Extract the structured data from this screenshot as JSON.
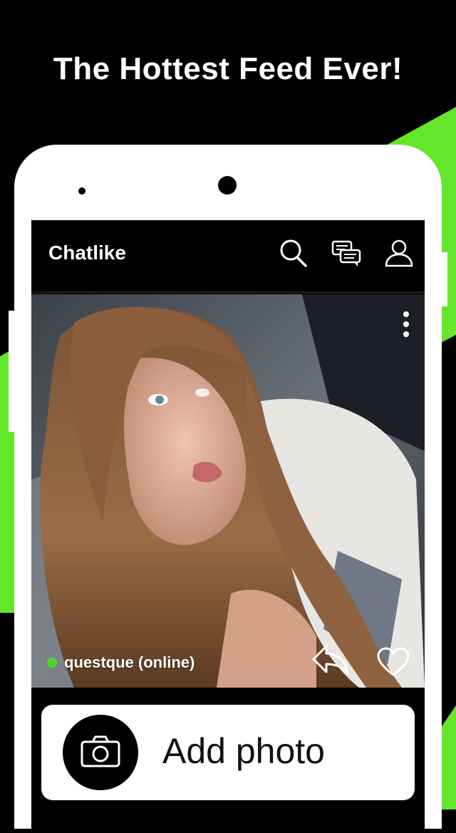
{
  "headline": "The Hottest Feed Ever!",
  "app": {
    "title": "Chatlike",
    "icons": [
      "search-icon",
      "chat-icon",
      "profile-icon"
    ]
  },
  "feed_item": {
    "username_status": "questque (online)",
    "online_color": "#4cd629",
    "actions": [
      "more-options-icon",
      "share-icon",
      "heart-icon"
    ]
  },
  "cta": {
    "label": "Add photo",
    "icon": "camera-icon"
  },
  "colors": {
    "accent_green": "#66e62a",
    "background": "#000000"
  }
}
